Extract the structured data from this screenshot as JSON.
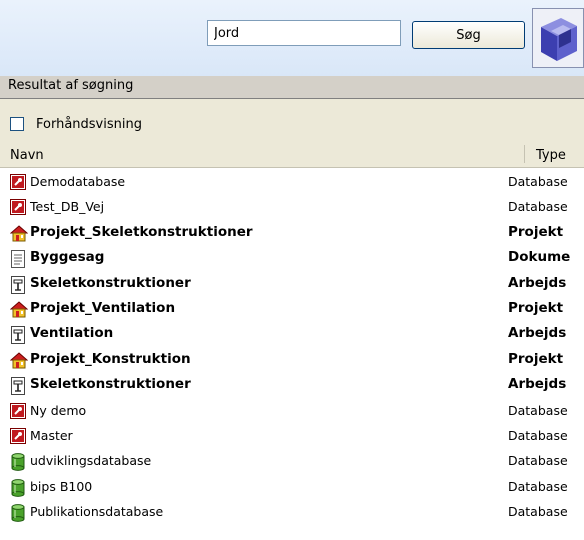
{
  "search": {
    "value": "Jord",
    "button_label": "Søg"
  },
  "results_header": "Resultat af søgning",
  "preview_label": "Forhåndsvisning",
  "columns": {
    "name": "Navn",
    "type": "Type"
  },
  "rows": [
    {
      "name": "Demodatabase",
      "type": "Database",
      "icon": "database-key-icon",
      "bold": false
    },
    {
      "name": "Test_DB_Vej",
      "type": "Database",
      "icon": "database-key-icon",
      "bold": false
    },
    {
      "name": "Projekt_Skeletkonstruktioner",
      "type": "Projekt",
      "icon": "project-house-icon",
      "bold": true
    },
    {
      "name": "Byggesag",
      "type": "Dokume",
      "icon": "document-icon",
      "bold": true
    },
    {
      "name": "Skeletkonstruktioner",
      "type": "Arbejds",
      "icon": "workspace-icon",
      "bold": true
    },
    {
      "name": "Projekt_Ventilation",
      "type": "Projekt",
      "icon": "project-house-icon",
      "bold": true
    },
    {
      "name": "Ventilation",
      "type": "Arbejds",
      "icon": "workspace-icon",
      "bold": true
    },
    {
      "name": "Projekt_Konstruktion",
      "type": "Projekt",
      "icon": "project-house-icon",
      "bold": true
    },
    {
      "name": "Skeletkonstruktioner",
      "type": "Arbejds",
      "icon": "workspace-icon",
      "bold": true
    },
    {
      "name": "Ny demo",
      "type": "Database",
      "icon": "database-key-icon",
      "bold": false
    },
    {
      "name": "Master",
      "type": "Database",
      "icon": "database-key-icon",
      "bold": false
    },
    {
      "name": "udviklingsdatabase",
      "type": "Database",
      "icon": "database-cylinder-icon",
      "bold": false
    },
    {
      "name": "bips B100",
      "type": "Database",
      "icon": "database-cylinder-icon",
      "bold": false
    },
    {
      "name": "Publikationsdatabase",
      "type": "Database",
      "icon": "database-cylinder-icon",
      "bold": false
    }
  ],
  "colors": {
    "key_red": "#c0191f",
    "house_red": "#cc1f1f",
    "house_yellow": "#f2c22c",
    "cylinder_green": "#4aa22b"
  }
}
